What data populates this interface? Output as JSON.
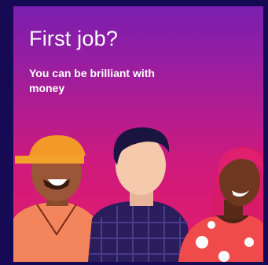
{
  "ad": {
    "headline": "First job?",
    "subline": "You can be brilliant with money"
  },
  "colors": {
    "frame": "#170a55",
    "gradient_top": "#7a1fb0",
    "gradient_bottom": "#e51c6a",
    "text": "#ffffff"
  },
  "illustration": {
    "people": [
      "person-orange-cap",
      "person-dark-hair-plaid-shirt",
      "person-red-hair-polka-dot"
    ]
  }
}
